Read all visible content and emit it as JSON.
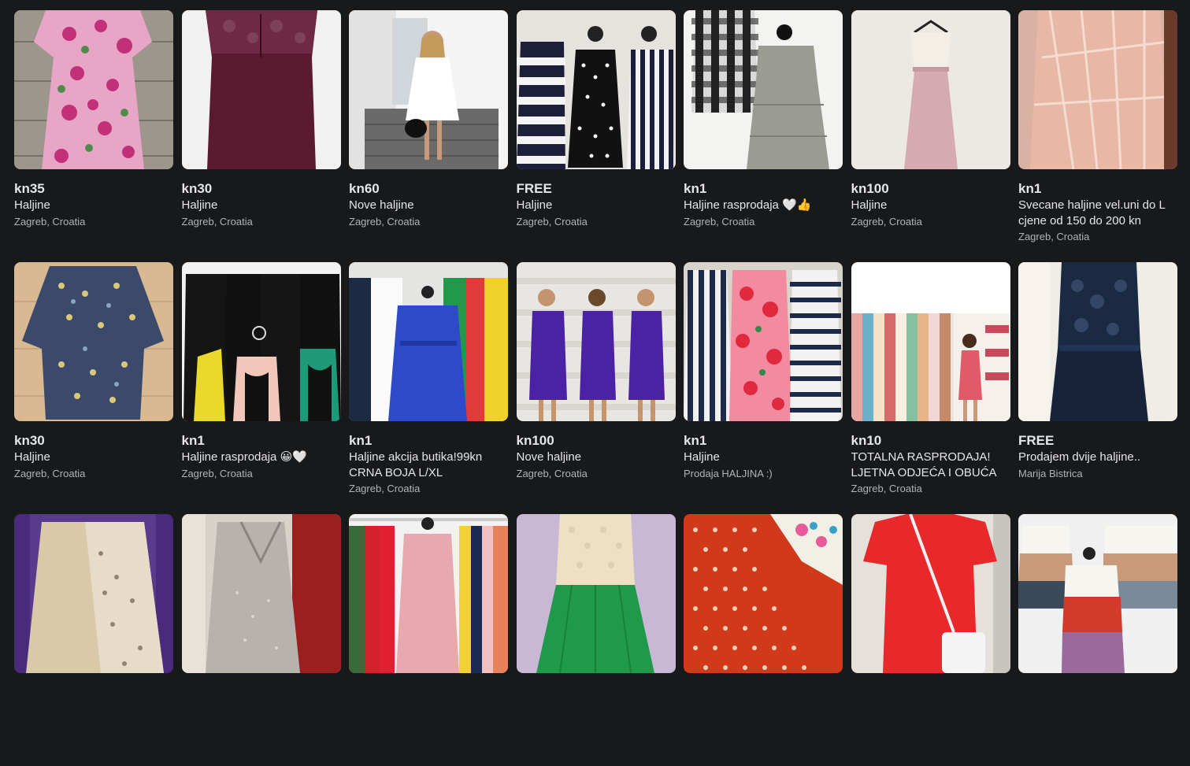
{
  "listings": [
    {
      "price": "kn35",
      "title": "Haljine",
      "location": "Zagreb, Croatia",
      "image": "floral-pink-dress"
    },
    {
      "price": "kn30",
      "title": "Haljine",
      "location": "Zagreb, Croatia",
      "image": "burgundy-lace-dress"
    },
    {
      "price": "kn60",
      "title": "Nove haljine",
      "location": "Zagreb, Croatia",
      "image": "white-dress-model"
    },
    {
      "price": "FREE",
      "title": "Haljine",
      "location": "Zagreb, Croatia",
      "image": "striped-dotted-dresses"
    },
    {
      "price": "kn1",
      "title": "Haljine rasprodaja 🤍👍",
      "location": "Zagreb, Croatia",
      "image": "gingham-grey-dresses"
    },
    {
      "price": "kn100",
      "title": "Haljine",
      "location": "Zagreb, Croatia",
      "image": "pink-maxi-dress"
    },
    {
      "price": "kn1",
      "title": "Svecane haljine vel.uni do L cjene od 150 do 200 kn",
      "location": "Zagreb, Croatia",
      "image": "peach-sequin-dress"
    },
    {
      "price": "kn30",
      "title": "Haljine",
      "location": "Zagreb, Croatia",
      "image": "blue-floral-dress"
    },
    {
      "price": "kn1",
      "title": "Haljine rasprodaja 😀🤍",
      "location": "Zagreb, Croatia",
      "image": "black-pleated-dresses"
    },
    {
      "price": "kn1",
      "title": "Haljine akcija butika!99kn CRNA BOJA L/XL",
      "location": "Zagreb, Croatia",
      "image": "colorful-rack-dresses"
    },
    {
      "price": "kn100",
      "title": "Nove haljine",
      "location": "Zagreb, Croatia",
      "image": "purple-dress-model"
    },
    {
      "price": "kn1",
      "title": "Haljine",
      "location": "Prodaja HALJINA :)",
      "image": "striped-floral-dresses"
    },
    {
      "price": "kn10",
      "title": "TOTALNA RASPRODAJA! LJETNA ODJEĆA I OBUĆA",
      "location": "Zagreb, Croatia",
      "image": "boutique-rack"
    },
    {
      "price": "FREE",
      "title": "Prodajem dvije haljine..",
      "location": "Marija Bistrica",
      "image": "navy-lace-dress"
    },
    {
      "price": "",
      "title": "",
      "location": "",
      "image": "leopard-skirt"
    },
    {
      "price": "",
      "title": "",
      "location": "",
      "image": "silver-gown"
    },
    {
      "price": "",
      "title": "",
      "location": "",
      "image": "rack-multicolor"
    },
    {
      "price": "",
      "title": "",
      "location": "",
      "image": "cream-green-dress"
    },
    {
      "price": "",
      "title": "",
      "location": "",
      "image": "red-polka-fabric"
    },
    {
      "price": "",
      "title": "",
      "location": "",
      "image": "red-tshirt-dress"
    },
    {
      "price": "",
      "title": "",
      "location": "",
      "image": "colorblock-dresses"
    }
  ],
  "colors": {
    "background": "#18191a",
    "text_primary": "#e4e6eb",
    "text_secondary": "#b0b3b8"
  }
}
